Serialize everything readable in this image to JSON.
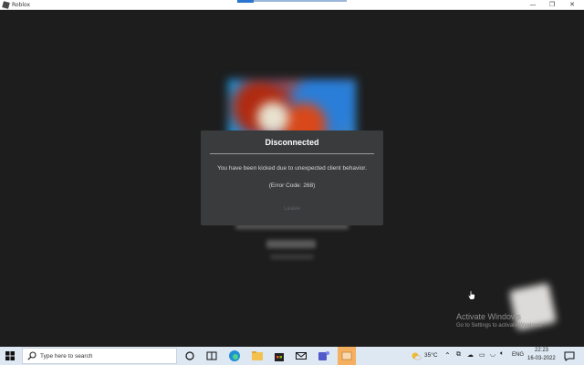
{
  "window": {
    "title": "Roblox",
    "controls": {
      "minimize": "—",
      "restore": "❐",
      "close": "✕"
    }
  },
  "dialog": {
    "title": "Disconnected",
    "message": "You have been kicked due to unexpected client behavior.",
    "error_code": "(Error Code: 268)",
    "leave_label": "Leave"
  },
  "watermark": {
    "title": "Activate Windows",
    "subtitle": "Go to Settings to activate Windows."
  },
  "taskbar": {
    "search_placeholder": "Type here to search",
    "pinned_apps": [
      "task-view-icon",
      "widgets-icon",
      "edge-icon",
      "file-explorer-icon",
      "store-icon",
      "mail-icon",
      "teams-icon",
      "roblox-icon"
    ],
    "weather_temp": "35°C",
    "language": "ENG",
    "time": "22:23",
    "date": "16-03-2022"
  },
  "colors": {
    "dialog_bg": "#393b3d",
    "backdrop": "#1d1d1d",
    "taskbar_bg": "#dde8f3",
    "active_app": "#f4b060"
  }
}
